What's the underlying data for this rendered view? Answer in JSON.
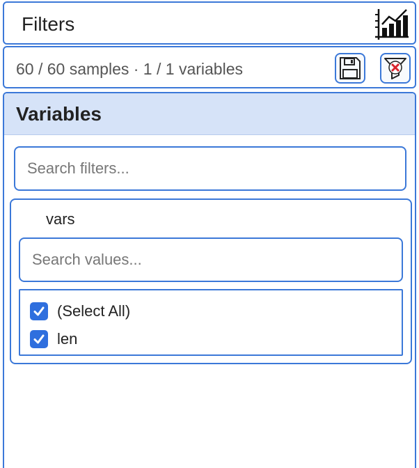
{
  "header": {
    "title": "Filters",
    "chart_icon": "bar-chart-icon"
  },
  "status": {
    "summary": "60 / 60 samples · 1 / 1 variables",
    "save_icon": "floppy-disk-icon",
    "clear_icon": "clear-filter-icon"
  },
  "variables_section": {
    "title": "Variables",
    "search_placeholder": "Search filters...",
    "variable": {
      "name": "vars",
      "search_placeholder": "Search values...",
      "options": [
        {
          "label": "(Select All)",
          "checked": true
        },
        {
          "label": "len",
          "checked": true
        }
      ]
    }
  },
  "colors": {
    "accent": "#3b78d8",
    "section_header_bg": "#d6e3f8",
    "checkbox": "#2f6fde",
    "clear_x": "#d9232d"
  }
}
